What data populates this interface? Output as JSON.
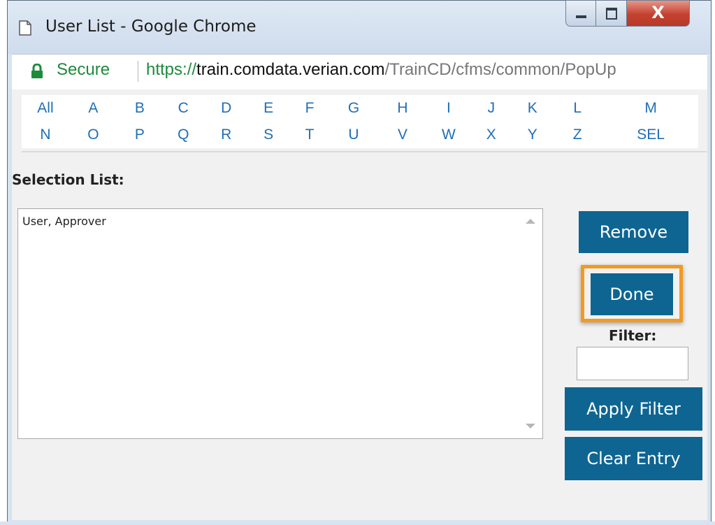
{
  "window": {
    "title": "User List - Google Chrome",
    "close_glyph": "X"
  },
  "address_bar": {
    "secure_label": "Secure",
    "url_scheme": "https://",
    "url_host": "train.comdata.verian.com",
    "url_path": "/TrainCD/cfms/common/PopUp"
  },
  "alphabet": {
    "row1": [
      "All",
      "A",
      "B",
      "C",
      "D",
      "E",
      "F",
      "G",
      "H",
      "I",
      "J",
      "K",
      "L",
      "M"
    ],
    "row2": [
      "N",
      "O",
      "P",
      "Q",
      "R",
      "S",
      "T",
      "U",
      "V",
      "W",
      "X",
      "Y",
      "Z",
      "SEL"
    ]
  },
  "selection": {
    "label": "Selection List:",
    "items": [
      "User, Approver"
    ]
  },
  "buttons": {
    "remove": "Remove",
    "done": "Done",
    "apply_filter": "Apply Filter",
    "clear_entry": "Clear Entry"
  },
  "filter": {
    "label": "Filter:",
    "value": ""
  },
  "colors": {
    "button_bg": "#0e6592",
    "highlight": "#f39a1e",
    "link": "#1f6fb5",
    "secure_green": "#1e8a3c"
  }
}
